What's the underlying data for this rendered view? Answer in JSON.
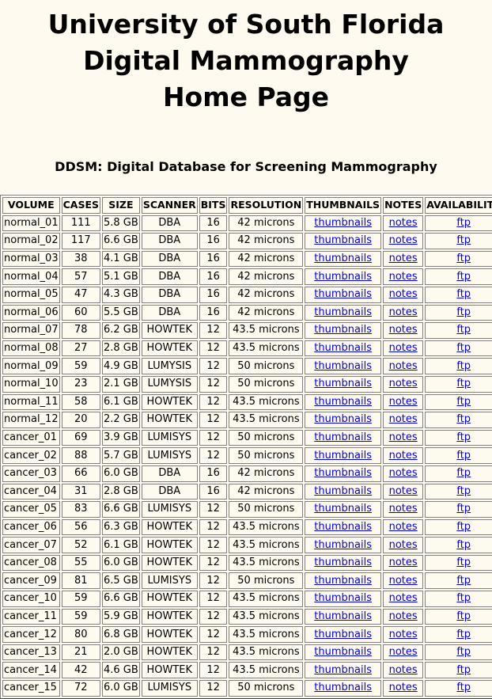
{
  "header": {
    "title_lines": [
      "University of South Florida",
      "Digital Mammography",
      "Home Page"
    ],
    "subtitle": "DDSM: Digital Database for Screening Mammography"
  },
  "table": {
    "columns": [
      "VOLUME",
      "CASES",
      "SIZE",
      "SCANNER",
      "BITS",
      "RESOLUTION",
      "THUMBNAILS",
      "NOTES",
      "AVAILABILITY"
    ],
    "link_labels": {
      "thumbnails": "thumbnails",
      "notes": "notes",
      "availability": "ftp"
    },
    "rows": [
      {
        "volume": "normal_01",
        "cases": "111",
        "size": "5.8 GB",
        "scanner": "DBA",
        "bits": "16",
        "resolution": "42 microns"
      },
      {
        "volume": "normal_02",
        "cases": "117",
        "size": "6.6 GB",
        "scanner": "DBA",
        "bits": "16",
        "resolution": "42 microns"
      },
      {
        "volume": "normal_03",
        "cases": "38",
        "size": "4.1 GB",
        "scanner": "DBA",
        "bits": "16",
        "resolution": "42 microns"
      },
      {
        "volume": "normal_04",
        "cases": "57",
        "size": "5.1 GB",
        "scanner": "DBA",
        "bits": "16",
        "resolution": "42 microns"
      },
      {
        "volume": "normal_05",
        "cases": "47",
        "size": "4.3 GB",
        "scanner": "DBA",
        "bits": "16",
        "resolution": "42 microns"
      },
      {
        "volume": "normal_06",
        "cases": "60",
        "size": "5.5 GB",
        "scanner": "DBA",
        "bits": "16",
        "resolution": "42 microns"
      },
      {
        "volume": "normal_07",
        "cases": "78",
        "size": "6.2 GB",
        "scanner": "HOWTEK",
        "bits": "12",
        "resolution": "43.5 microns"
      },
      {
        "volume": "normal_08",
        "cases": "27",
        "size": "2.8 GB",
        "scanner": "HOWTEK",
        "bits": "12",
        "resolution": "43.5 microns"
      },
      {
        "volume": "normal_09",
        "cases": "59",
        "size": "4.9 GB",
        "scanner": "LUMYSIS",
        "bits": "12",
        "resolution": "50 microns"
      },
      {
        "volume": "normal_10",
        "cases": "23",
        "size": "2.1 GB",
        "scanner": "LUMYSIS",
        "bits": "12",
        "resolution": "50 microns"
      },
      {
        "volume": "normal_11",
        "cases": "58",
        "size": "6.1 GB",
        "scanner": "HOWTEK",
        "bits": "12",
        "resolution": "43.5 microns"
      },
      {
        "volume": "normal_12",
        "cases": "20",
        "size": "2.2 GB",
        "scanner": "HOWTEK",
        "bits": "12",
        "resolution": "43.5 microns"
      },
      {
        "volume": "cancer_01",
        "cases": "69",
        "size": "3.9 GB",
        "scanner": "LUMISYS",
        "bits": "12",
        "resolution": "50 microns"
      },
      {
        "volume": "cancer_02",
        "cases": "88",
        "size": "5.7 GB",
        "scanner": "LUMISYS",
        "bits": "12",
        "resolution": "50 microns"
      },
      {
        "volume": "cancer_03",
        "cases": "66",
        "size": "6.0 GB",
        "scanner": "DBA",
        "bits": "16",
        "resolution": "42 microns"
      },
      {
        "volume": "cancer_04",
        "cases": "31",
        "size": "2.8 GB",
        "scanner": "DBA",
        "bits": "16",
        "resolution": "42 microns"
      },
      {
        "volume": "cancer_05",
        "cases": "83",
        "size": "6.6 GB",
        "scanner": "LUMISYS",
        "bits": "12",
        "resolution": "50 microns"
      },
      {
        "volume": "cancer_06",
        "cases": "56",
        "size": "6.3 GB",
        "scanner": "HOWTEK",
        "bits": "12",
        "resolution": "43.5 microns"
      },
      {
        "volume": "cancer_07",
        "cases": "52",
        "size": "6.1 GB",
        "scanner": "HOWTEK",
        "bits": "12",
        "resolution": "43.5 microns"
      },
      {
        "volume": "cancer_08",
        "cases": "55",
        "size": "6.0 GB",
        "scanner": "HOWTEK",
        "bits": "12",
        "resolution": "43.5 microns"
      },
      {
        "volume": "cancer_09",
        "cases": "81",
        "size": "6.5 GB",
        "scanner": "LUMISYS",
        "bits": "12",
        "resolution": "50 microns"
      },
      {
        "volume": "cancer_10",
        "cases": "59",
        "size": "6.6 GB",
        "scanner": "HOWTEK",
        "bits": "12",
        "resolution": "43.5 microns"
      },
      {
        "volume": "cancer_11",
        "cases": "59",
        "size": "5.9 GB",
        "scanner": "HOWTEK",
        "bits": "12",
        "resolution": "43.5 microns"
      },
      {
        "volume": "cancer_12",
        "cases": "80",
        "size": "6.8 GB",
        "scanner": "HOWTEK",
        "bits": "12",
        "resolution": "43.5 microns"
      },
      {
        "volume": "cancer_13",
        "cases": "21",
        "size": "2.0 GB",
        "scanner": "HOWTEK",
        "bits": "12",
        "resolution": "43.5 microns"
      },
      {
        "volume": "cancer_14",
        "cases": "42",
        "size": "4.6 GB",
        "scanner": "HOWTEK",
        "bits": "12",
        "resolution": "43.5 microns"
      },
      {
        "volume": "cancer_15",
        "cases": "72",
        "size": "6.0 GB",
        "scanner": "LUMISYS",
        "bits": "12",
        "resolution": "50 microns"
      }
    ]
  },
  "colors": {
    "background": "#fffaf0",
    "link": "#0000ee",
    "border": "#808080"
  }
}
